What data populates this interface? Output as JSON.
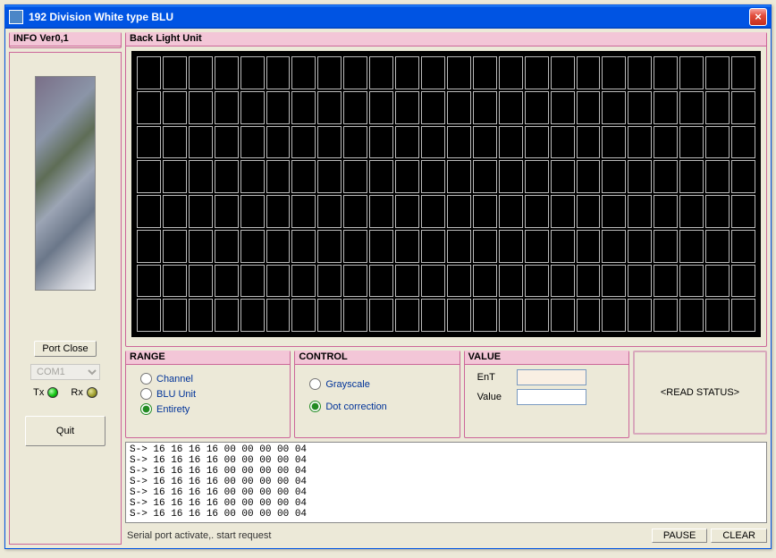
{
  "window": {
    "title": "192 Division White type BLU"
  },
  "info": {
    "header": "INFO Ver0,1",
    "port_close_label": "Port Close",
    "com_port": "COM1",
    "tx_label": "Tx",
    "rx_label": "Rx",
    "quit_label": "Quit"
  },
  "blu": {
    "header": "Back Light Unit",
    "grid_cols": 24,
    "grid_rows": 8
  },
  "range": {
    "header": "RANGE",
    "channel": "Channel",
    "blu_unit": "BLU Unit",
    "entirety": "Entirety",
    "selected": "entirety"
  },
  "control": {
    "header": "CONTROL",
    "grayscale": "Grayscale",
    "dot": "Dot correction",
    "selected": "dot"
  },
  "value": {
    "header": "VALUE",
    "ent_label": "EnT",
    "ent_value": "",
    "value_label": "Value",
    "value_value": ""
  },
  "read_status_label": "<READ STATUS>",
  "log_lines": [
    "S-> 16 16 16 16 00 00 00 00 04",
    "S-> 16 16 16 16 00 00 00 00 04",
    "S-> 16 16 16 16 00 00 00 00 04",
    "S-> 16 16 16 16 00 00 00 00 04",
    "S-> 16 16 16 16 00 00 00 00 04",
    "S-> 16 16 16 16 00 00 00 00 04",
    "S-> 16 16 16 16 00 00 00 00 04"
  ],
  "status_text": "Serial port activate,.  start request",
  "pause_label": "PAUSE",
  "clear_label": "CLEAR"
}
